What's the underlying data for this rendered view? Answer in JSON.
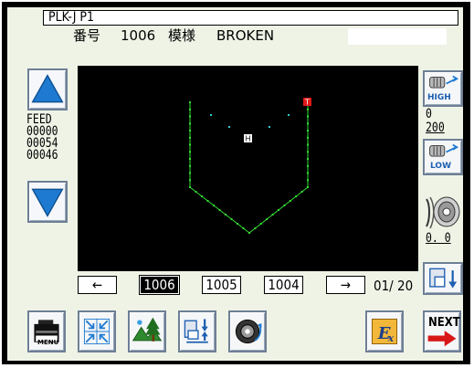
{
  "header": {
    "title": "PLK-J P1",
    "number_label": "番号",
    "number_value": "1006",
    "pattern_label": "模様",
    "pattern_value": "BROKEN"
  },
  "left_panel": {
    "feed_label": "FEED",
    "feed_values": [
      "00000",
      "00054",
      "00046"
    ]
  },
  "right_panel": {
    "high_label": "HIGH",
    "low_label": "LOW",
    "speed_top": "0",
    "speed_bottom": "200",
    "tension_value": "0. 0"
  },
  "plot": {
    "home_marker": "H",
    "end_marker": "T",
    "stitch_color": "#33dd33",
    "marker_color": "#e01818"
  },
  "nav": {
    "prev_arrow": "←",
    "next_arrow": "→",
    "patterns": [
      "1006",
      "1005",
      "1004"
    ],
    "selected": "1006",
    "page": "01/ 20"
  },
  "toolbar": {
    "menu_label": "MENU",
    "next_label": "NEXT"
  }
}
